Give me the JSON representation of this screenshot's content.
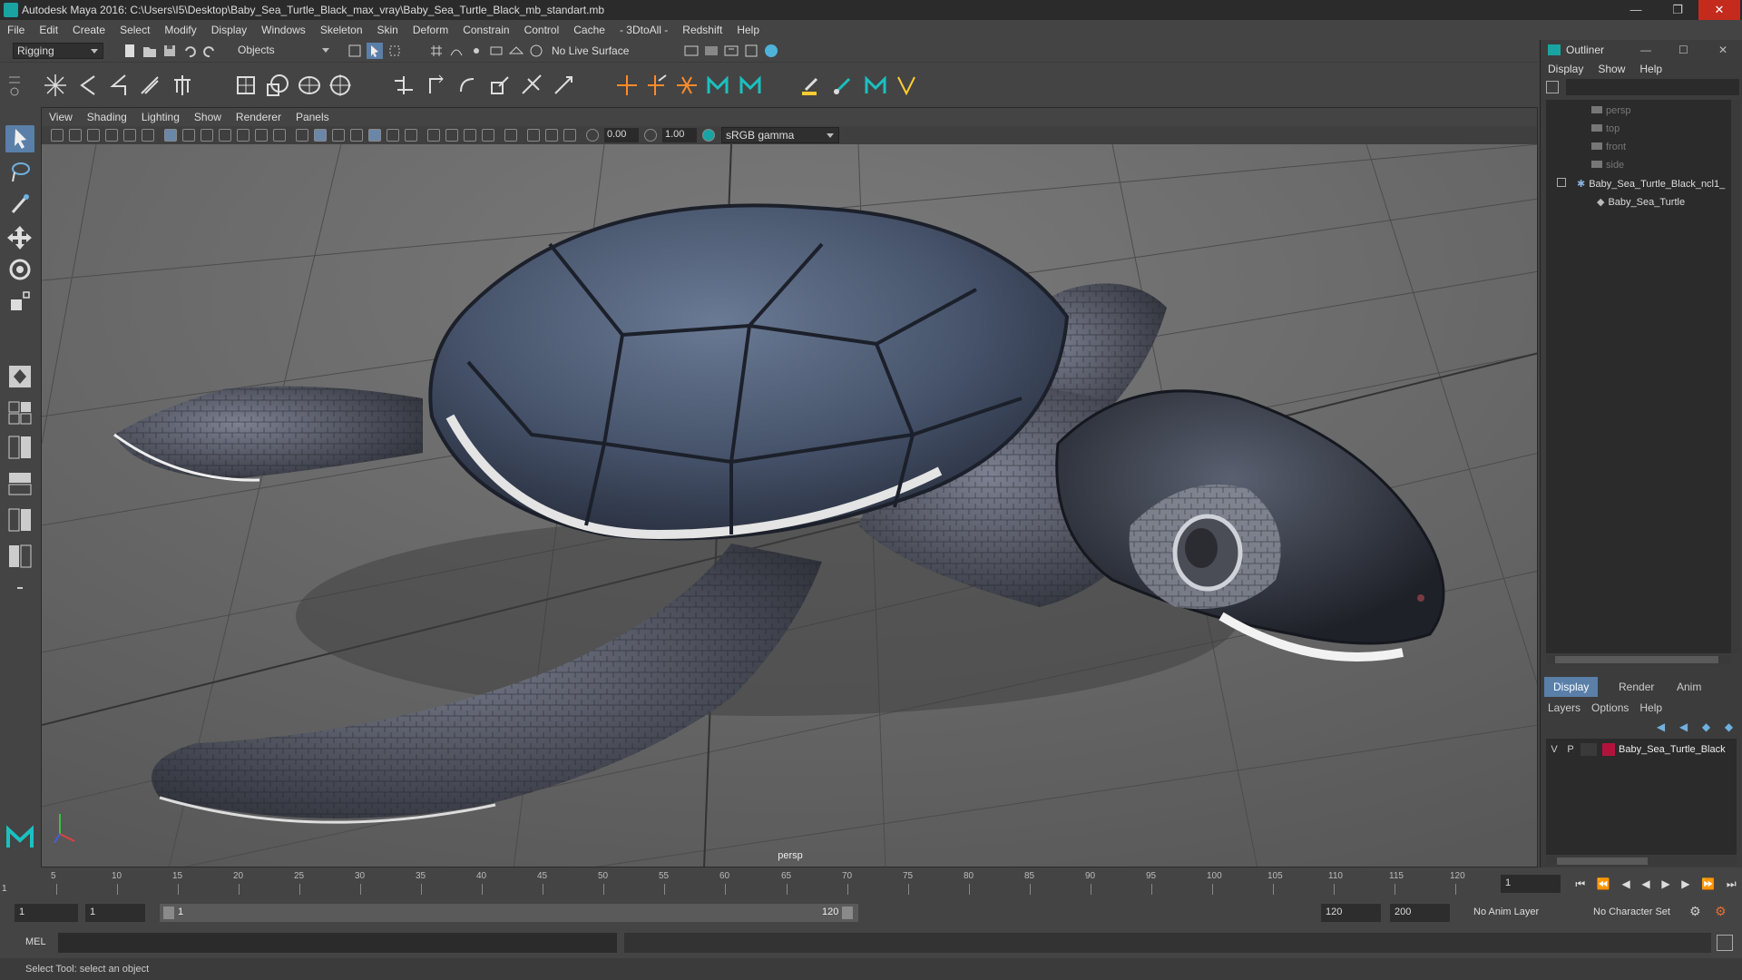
{
  "window": {
    "title": "Autodesk Maya 2016: C:\\Users\\I5\\Desktop\\Baby_Sea_Turtle_Black_max_vray\\Baby_Sea_Turtle_Black_mb_standart.mb"
  },
  "menu": [
    "File",
    "Edit",
    "Create",
    "Select",
    "Modify",
    "Display",
    "Windows",
    "Skeleton",
    "Skin",
    "Deform",
    "Constrain",
    "Control",
    "Cache",
    "- 3DtoAll -",
    "Redshift",
    "Help"
  ],
  "status": {
    "mode": "Rigging",
    "objects_label": "Objects",
    "live_surface": "No Live Surface"
  },
  "viewport": {
    "menu": [
      "View",
      "Shading",
      "Lighting",
      "Show",
      "Renderer",
      "Panels"
    ],
    "exposure": "0.00",
    "gamma": "1.00",
    "color_space": "sRGB gamma",
    "camera_label": "persp"
  },
  "outliner": {
    "title": "Outliner",
    "menu": [
      "Display",
      "Show",
      "Help"
    ],
    "items": [
      "persp",
      "top",
      "front",
      "side",
      "Baby_Sea_Turtle_Black_ncl1_",
      "Baby_Sea_Turtle"
    ]
  },
  "layers": {
    "tabs": [
      "Display",
      "Render",
      "Anim"
    ],
    "menu": [
      "Layers",
      "Options",
      "Help"
    ],
    "layer": {
      "v": "V",
      "p": "P",
      "name": "Baby_Sea_Turtle_Black",
      "color": "#b0143c"
    }
  },
  "timeline": {
    "ticks": [
      "5",
      "10",
      "15",
      "20",
      "25",
      "30",
      "35",
      "40",
      "45",
      "50",
      "55",
      "60",
      "65",
      "70",
      "75",
      "80",
      "85",
      "90",
      "95",
      "100",
      "105",
      "110",
      "115",
      "120"
    ],
    "start_label": "1",
    "current_frame": "1"
  },
  "range": {
    "start": "1",
    "start2": "1",
    "slider_start": "1",
    "slider_end": "120",
    "end": "120",
    "max_end": "200",
    "anim_layer": "No Anim Layer",
    "character_set": "No Character Set"
  },
  "cmd": {
    "label": "MEL"
  },
  "help": {
    "text": "Select Tool: select an object"
  }
}
